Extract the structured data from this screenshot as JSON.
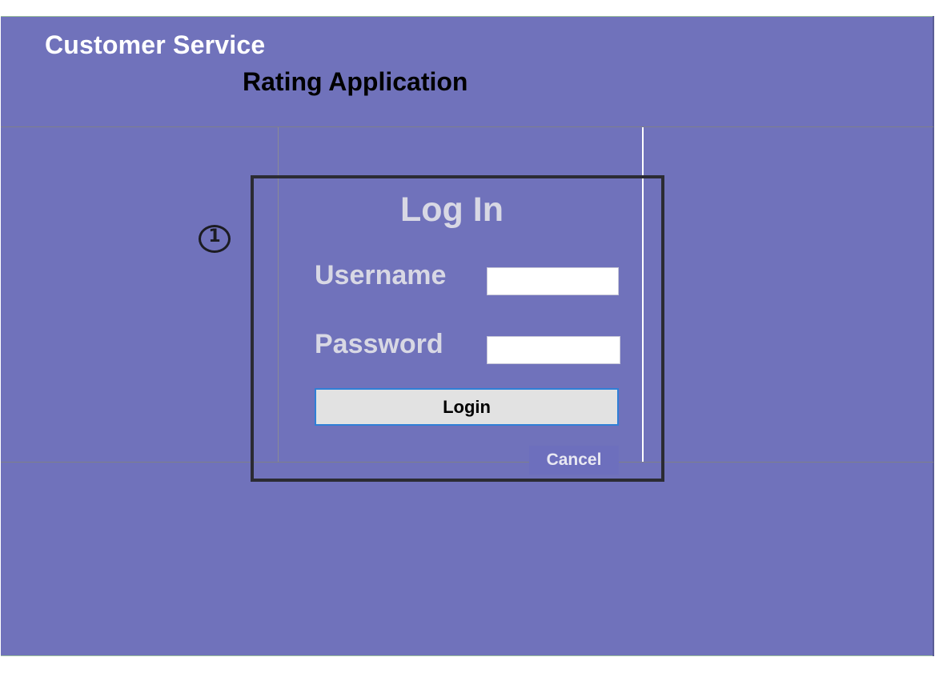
{
  "header": {
    "title": "Customer Service",
    "subtitle": "Rating Application"
  },
  "annotation": {
    "marker_number": "1"
  },
  "login": {
    "heading": "Log In",
    "username_label": "Username",
    "username_value": "",
    "password_label": "Password",
    "password_value": "",
    "login_button_label": "Login",
    "cancel_button_label": "Cancel"
  },
  "colors": {
    "background": "#7072bb",
    "callout_border": "#2b2b33",
    "login_button_border": "#2f7fd6",
    "login_button_fill": "#e2e2e2",
    "label_text": "#d8d8e4"
  }
}
